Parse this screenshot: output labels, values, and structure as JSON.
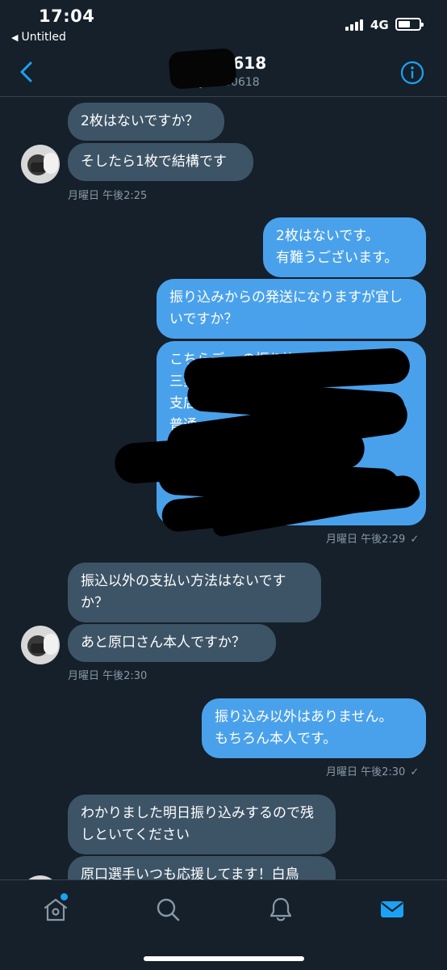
{
  "status_bar": {
    "time": "17:04",
    "back_app": "Untitled",
    "network": "4G"
  },
  "header": {
    "title": "yuto0618",
    "handle": "@yutoo0618",
    "back_icon": "chevron-left-icon",
    "info_icon": "info-icon"
  },
  "messages": [
    {
      "side": "in",
      "text": "2枚はないですか？"
    },
    {
      "side": "in",
      "text": "そしたら1枚で結構です"
    },
    {
      "timestamp": "月曜日 午後2:25"
    },
    {
      "side": "out",
      "text": "2枚はないです。\n有難うございます。"
    },
    {
      "side": "out",
      "text": "振り込みからの発送になりますが宜しいですか？"
    },
    {
      "side": "out",
      "text": "こちらデ... の振り込み先になりま...\n三菱UFJ銀行\n支店\n普通\nハラグチ ケント\n...この郵便番号...\nください"
    },
    {
      "timestamp": "月曜日 午後2:29",
      "read": "✓"
    },
    {
      "side": "in",
      "text": "振込以外の支払い方法はないですか？"
    },
    {
      "side": "in",
      "text": "あと原口さん本人ですか？"
    },
    {
      "timestamp": "月曜日 午後2:30"
    },
    {
      "side": "out",
      "text": "振り込み以外はありません。\nもちろん本人です。"
    },
    {
      "timestamp": "月曜日 午後2:30",
      "read": "✓"
    },
    {
      "side": "in",
      "text": "わかりました明日振り込みするので残しといてください"
    },
    {
      "side": "in",
      "text": "原口選手いつも応援してます！白鳥"
    }
  ],
  "tabbar": {
    "items": [
      "home-icon",
      "search-icon",
      "bell-icon",
      "mail-icon"
    ],
    "active": "mail-icon",
    "accent": "#1da1f2"
  },
  "colors": {
    "background": "#15202b",
    "incoming_bubble": "#3d5466",
    "outgoing_bubble": "#4aa1eb",
    "secondary_text": "#8899a6"
  }
}
